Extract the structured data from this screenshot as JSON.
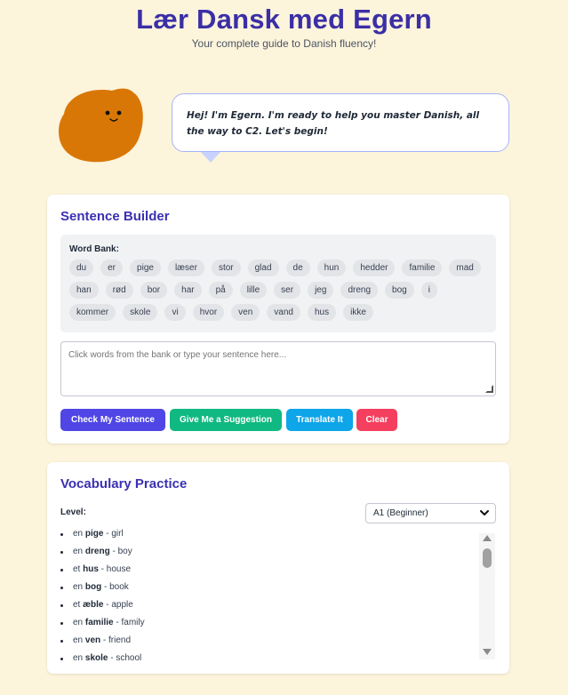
{
  "header": {
    "title": "Lær Dansk med Egern",
    "subtitle": "Your complete guide to Danish fluency!"
  },
  "mascot": {
    "speech": "Hej! I'm Egern. I'm ready to help you master Danish, all the way to C2. Let's begin!",
    "color": "#d97706"
  },
  "sentence_builder": {
    "title": "Sentence Builder",
    "word_bank_label": "Word Bank:",
    "words": [
      "du",
      "er",
      "pige",
      "læser",
      "stor",
      "glad",
      "de",
      "hun",
      "hedder",
      "familie",
      "mad",
      "han",
      "rød",
      "bor",
      "har",
      "på",
      "lille",
      "ser",
      "jeg",
      "dreng",
      "bog",
      "i",
      "kommer",
      "skole",
      "vi",
      "hvor",
      "ven",
      "vand",
      "hus",
      "ikke"
    ],
    "placeholder": "Click words from the bank or type your sentence here...",
    "buttons": {
      "check": "Check My Sentence",
      "suggest": "Give Me a Suggestion",
      "translate": "Translate It",
      "clear": "Clear"
    }
  },
  "vocabulary": {
    "title": "Vocabulary Practice",
    "level_label": "Level:",
    "level_selected": "A1 (Beginner)",
    "items": [
      {
        "article": "en",
        "word": "pige",
        "meaning": "girl"
      },
      {
        "article": "en",
        "word": "dreng",
        "meaning": "boy"
      },
      {
        "article": "et",
        "word": "hus",
        "meaning": "house"
      },
      {
        "article": "en",
        "word": "bog",
        "meaning": "book"
      },
      {
        "article": "et",
        "word": "æble",
        "meaning": "apple"
      },
      {
        "article": "en",
        "word": "familie",
        "meaning": "family"
      },
      {
        "article": "en",
        "word": "ven",
        "meaning": "friend"
      },
      {
        "article": "en",
        "word": "skole",
        "meaning": "school"
      }
    ]
  },
  "colors": {
    "background": "#fdf4dc",
    "accent": "#3b2fa6",
    "check": "#4f46e5",
    "suggest": "#10b981",
    "translate": "#0ea5e9",
    "clear": "#f43f5e"
  }
}
